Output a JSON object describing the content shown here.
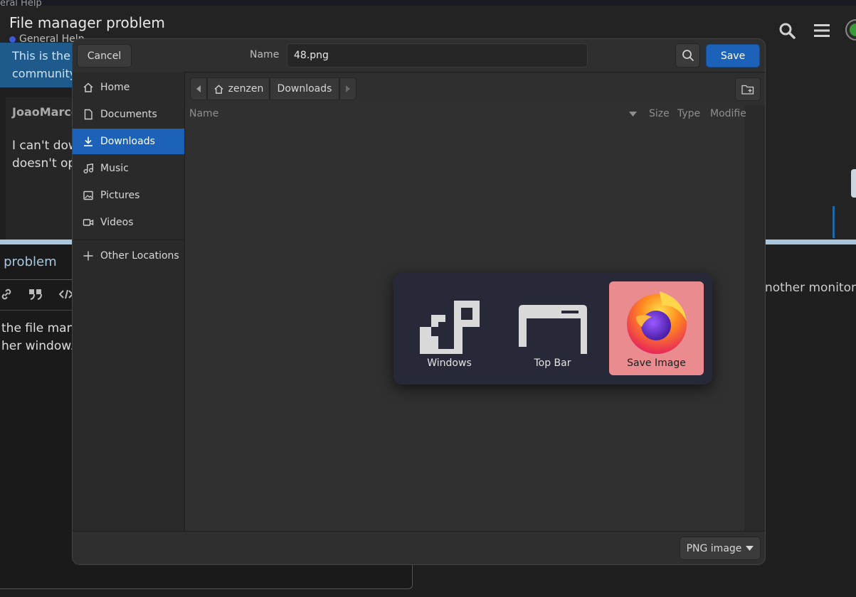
{
  "background_page": {
    "crumb_top": "eral Help",
    "title": "File manager problem",
    "category": "General Help",
    "banner_lines": [
      "This is the",
      "community"
    ],
    "author": "JoaoMarco",
    "body_lines": [
      "I can't dow",
      "doesn't op"
    ],
    "composer_title": "r problem",
    "composer_body": [
      "the file mana",
      "her window."
    ],
    "right_text": "nother monitor o",
    "colors": {
      "banner": "#1e5a8c",
      "divider": "#a9c6dc",
      "category_dot": "#3c5bd8"
    }
  },
  "dialog": {
    "cancel_label": "Cancel",
    "name_label": "Name",
    "filename": "48.png",
    "save_label": "Save",
    "sidebar": {
      "items": [
        {
          "label": "Home",
          "icon": "home-icon"
        },
        {
          "label": "Documents",
          "icon": "document-icon"
        },
        {
          "label": "Downloads",
          "icon": "download-icon",
          "active": true
        },
        {
          "label": "Music",
          "icon": "music-icon"
        },
        {
          "label": "Pictures",
          "icon": "picture-icon"
        },
        {
          "label": "Videos",
          "icon": "video-icon"
        }
      ],
      "other_locations": "Other Locations"
    },
    "path": [
      "zenzen",
      "Downloads"
    ],
    "columns": [
      "Name",
      "Size",
      "Type",
      "Modifie"
    ],
    "file_type": "PNG image",
    "accent": "#1c62b9"
  },
  "switcher": {
    "items": [
      {
        "label": "Windows",
        "icon": "windows-overview-icon"
      },
      {
        "label": "Top Bar",
        "icon": "top-bar-icon"
      },
      {
        "label": "Save Image",
        "icon": "firefox-icon",
        "selected": true
      }
    ],
    "selected_color": "#e98b8f"
  }
}
